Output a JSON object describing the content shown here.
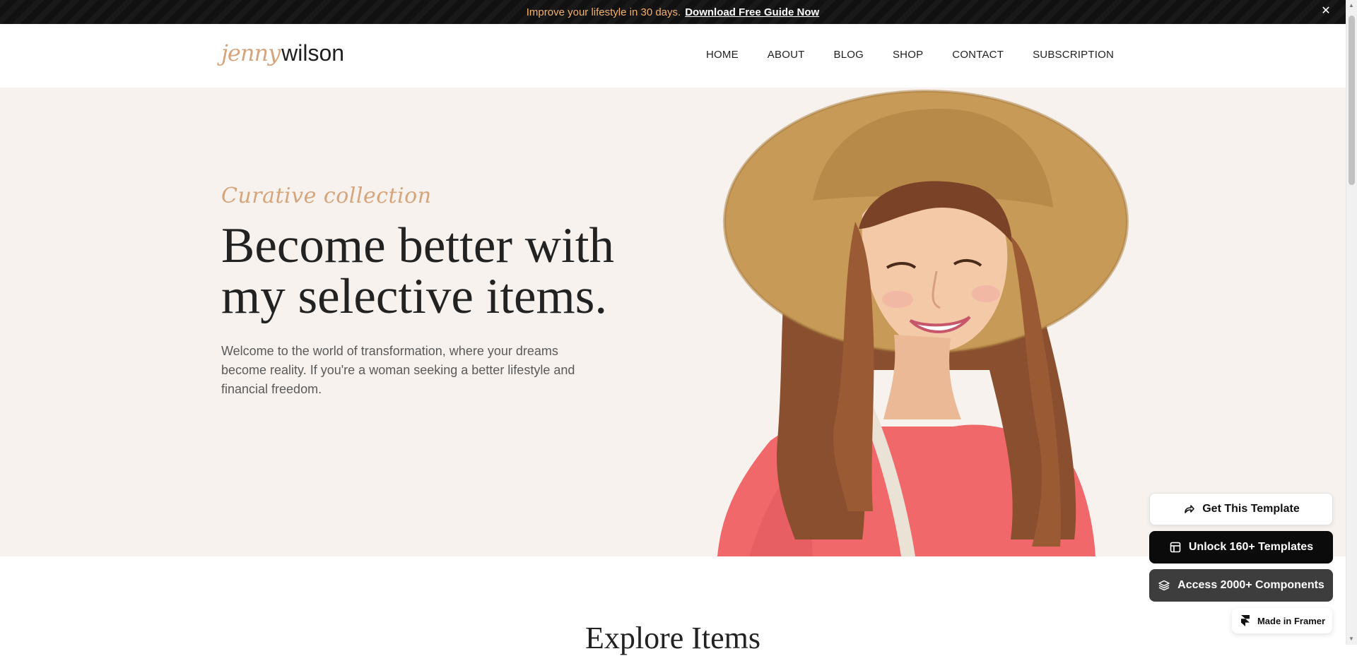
{
  "announcement": {
    "message": "Improve your lifestyle in 30 days.",
    "link": "Download Free Guide Now",
    "close_icon": "close-icon"
  },
  "header": {
    "logo_part1": "jenny",
    "logo_part2": "wilson",
    "nav": [
      "HOME",
      "ABOUT",
      "BLOG",
      "SHOP",
      "CONTACT",
      "SUBSCRIPTION"
    ]
  },
  "hero": {
    "kicker": "Curative collection",
    "headline_line1": "Become better with",
    "headline_line2": "my selective items.",
    "description": "Welcome to the world of transformation, where your dreams become reality. If you're a woman seeking a better lifestyle and financial freedom."
  },
  "widgets": {
    "get_template": "Get This Template",
    "unlock_templates": "Unlock 160+ Templates",
    "access_components": "Access 2000+ Components",
    "made_in_framer": "Made in Framer"
  },
  "section": {
    "explore_title": "Explore Items"
  },
  "colors": {
    "accent": "#d6a57c",
    "hero_bg": "#f7f2ee",
    "announce_link": "#ffffff",
    "announce_text": "#f3b06b"
  }
}
